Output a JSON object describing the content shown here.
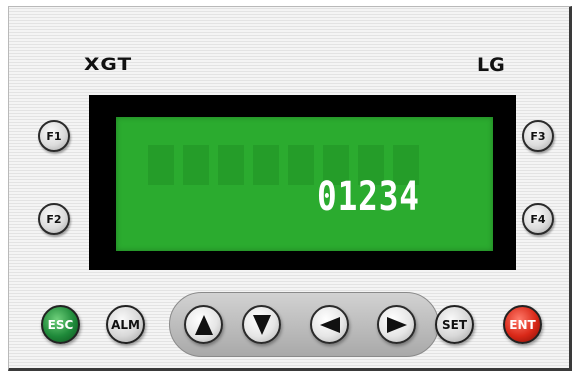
{
  "brand": {
    "left": "XGT",
    "right": "LG"
  },
  "display": {
    "value": "01234"
  },
  "function_keys": {
    "f1": "F1",
    "f2": "F2",
    "f3": "F3",
    "f4": "F4"
  },
  "buttons": {
    "esc": "ESC",
    "alm": "ALM",
    "set": "SET",
    "ent": "ENT"
  },
  "arrows": [
    "arrow-up-icon",
    "arrow-down-icon",
    "arrow-left-icon",
    "arrow-right-icon"
  ],
  "colors": {
    "lcd": "#2bab2f",
    "esc": "#1f8a3a",
    "ent": "#d92818"
  }
}
